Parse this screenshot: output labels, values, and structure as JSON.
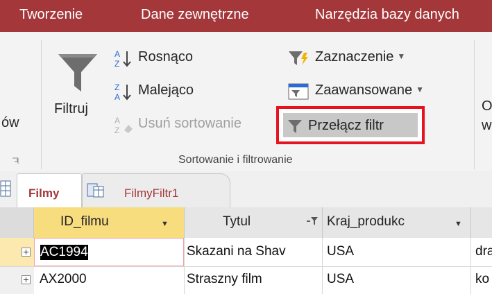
{
  "ribbon_tabs": [
    "Tworzenie",
    "Dane zewnętrzne",
    "Narzędzia bazy danych"
  ],
  "ribbon": {
    "left_cut_label": "ów",
    "filter_button": "Filtruj",
    "sort_ascending": "Rosnąco",
    "sort_descending": "Malejąco",
    "remove_sort": "Usuń sortowanie",
    "selection": "Zaznaczenie",
    "advanced": "Zaawansowane",
    "toggle_filter": "Przełącz filtr",
    "group_label": "Sortowanie i filtrowanie",
    "right_cut_top": "O",
    "right_cut_bottom": "ws"
  },
  "object_tabs": [
    "Filmy",
    "FilmyFiltr1"
  ],
  "table": {
    "columns": [
      "ID_filmu",
      "Tytul",
      "Kraj_produkc"
    ],
    "rows": [
      {
        "id": "AC1994",
        "tytul": "Skazani na Shav",
        "kraj": "USA",
        "extra": "dra"
      },
      {
        "id": "AX2000",
        "tytul": "Straszny film",
        "kraj": "USA",
        "extra": "ko"
      }
    ]
  },
  "colors": {
    "ribbon_tab_bg": "#a4373a",
    "ribbon_bg": "#f3f3f3",
    "highlight_border": "#e8111f",
    "selected_header": "#f7dd7e",
    "selected_row": "#fbe9b0"
  }
}
